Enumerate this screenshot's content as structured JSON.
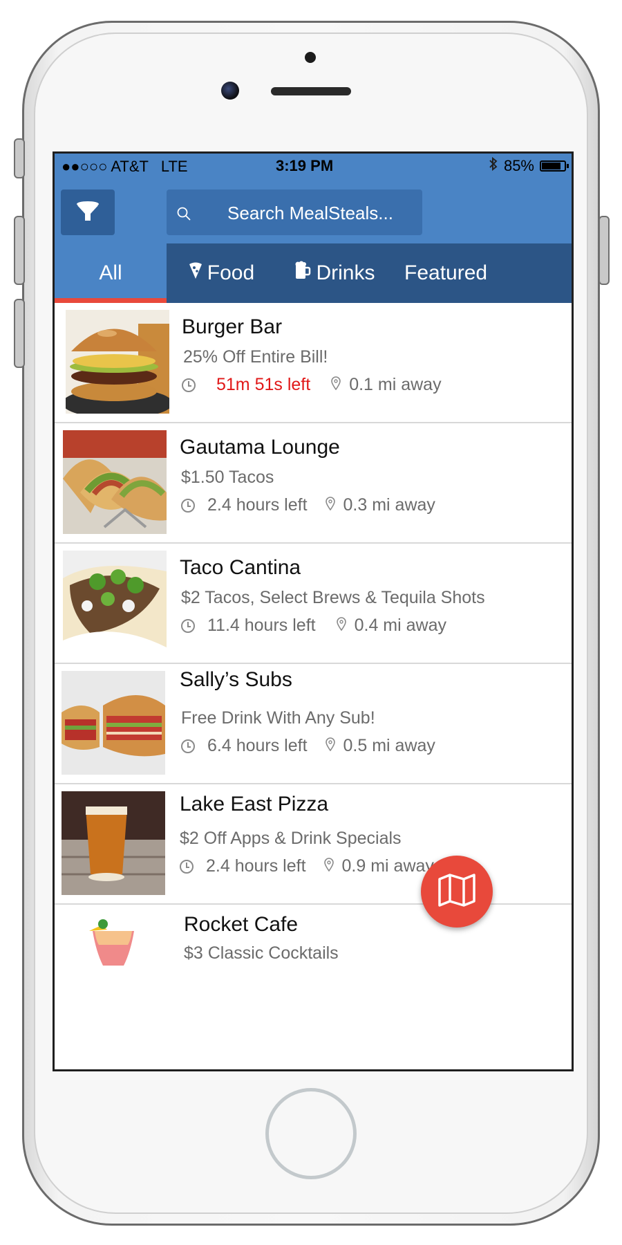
{
  "status_bar": {
    "carrier": "●●○○○ AT&T",
    "network": "LTE",
    "time": "3:19 PM",
    "battery": "85%",
    "battery_level": 0.85
  },
  "header": {
    "search_placeholder": "Search MealSteals...",
    "filter_icon": "filter-funnel-icon",
    "search_icon": "search-icon"
  },
  "tabs": [
    {
      "label": "All",
      "active": true
    },
    {
      "label": "Food",
      "icon": "pizza-slice-icon"
    },
    {
      "label": "Drinks",
      "icon": "beer-mug-icon"
    },
    {
      "label": "Featured"
    }
  ],
  "deals": [
    {
      "name": "Burger Bar",
      "deal": "25% Off Entire Bill!",
      "time_left": "51m 51s left",
      "distance": "0.1 mi away",
      "urgent": true,
      "image": "burger"
    },
    {
      "name": "Gautama Lounge",
      "deal": "$1.50 Tacos",
      "time_left": "2.4 hours left",
      "distance": "0.3 mi away",
      "image": "tacos"
    },
    {
      "name": "Taco Cantina",
      "deal": "$2 Tacos, Select Brews & Tequila Shots",
      "time_left": "11.4 hours left",
      "distance": "0.4 mi away",
      "image": "taco"
    },
    {
      "name": "Sally’s Subs",
      "deal": "Free Drink With Any Sub!",
      "time_left": "6.4 hours left",
      "distance": "0.5 mi away",
      "image": "sub"
    },
    {
      "name": "Lake East Pizza",
      "deal": "$2 Off Apps & Drink Specials",
      "time_left": "2.4 hours left",
      "distance": "0.9 mi away",
      "image": "beer"
    },
    {
      "name": "Rocket Cafe",
      "deal": "$3 Classic Cocktails",
      "image": "cocktail"
    }
  ],
  "fab": {
    "icon": "map-icon"
  },
  "colors": {
    "header_blue": "#4a84c5",
    "tabbar_blue": "#2c5586",
    "accent_red": "#e8493b",
    "urgent_red": "#e11818"
  }
}
